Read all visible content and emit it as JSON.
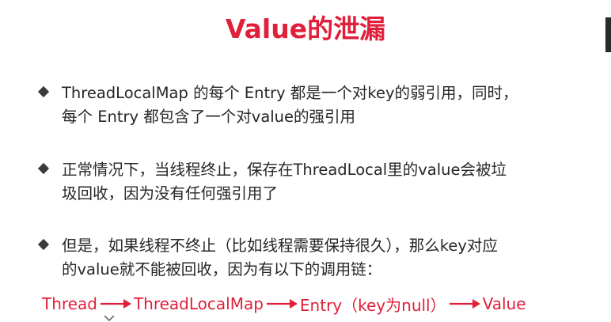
{
  "slide": {
    "title": "Value的泄漏",
    "bullets": [
      {
        "text": "ThreadLocalMap 的每个 Entry 都是一个对key的弱引用，同时，\n每个 Entry 都包含了一个对value的强引用"
      },
      {
        "text": "正常情况下，当线程终止，保存在ThreadLocal里的value会被垃\n圾回收，因为没有任何强引用了"
      },
      {
        "text": "但是，如果线程不终止（比如线程需要保持很久），那么key对应\n的value就不能被回收，因为有以下的调用链："
      }
    ],
    "chain": {
      "steps": [
        "Thread",
        "ThreadLocalMap",
        "Entry（key为null）",
        "Value"
      ]
    },
    "colors": {
      "accent": "#e0203a",
      "text": "#262626",
      "bullet": "#3a3a3a"
    }
  }
}
